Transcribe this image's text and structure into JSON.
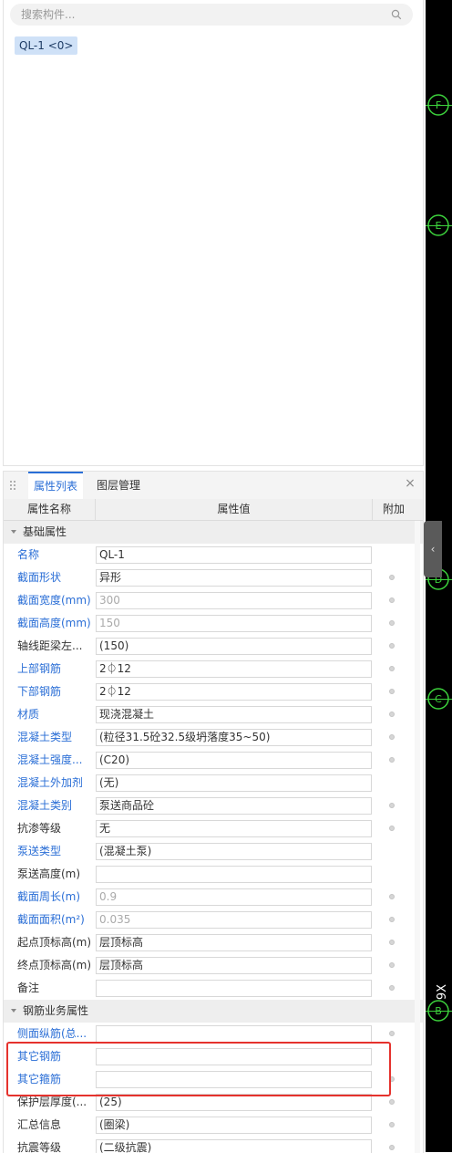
{
  "search": {
    "placeholder": "搜索构件..."
  },
  "tag": {
    "label": "QL-1 <0>"
  },
  "panel": {
    "tabs": [
      {
        "label": "属性列表"
      },
      {
        "label": "图层管理"
      }
    ],
    "close_label": "×",
    "columns": {
      "name": "属性名称",
      "value": "属性值",
      "extra": "附加"
    },
    "groups": [
      {
        "label": "基础属性"
      },
      {
        "label": "钢筋业务属性"
      }
    ],
    "rows": [
      {
        "name": "名称",
        "value": "QL-1"
      },
      {
        "name": "截面形状",
        "value": "异形"
      },
      {
        "name": "截面宽度(mm)",
        "value": "300"
      },
      {
        "name": "截面高度(mm)",
        "value": "150"
      },
      {
        "name": "轴线距梁左...",
        "value": "(150)"
      },
      {
        "name": "上部钢筋",
        "value": "2⏀12"
      },
      {
        "name": "下部钢筋",
        "value": "2⏀12"
      },
      {
        "name": "材质",
        "value": "现浇混凝土"
      },
      {
        "name": "混凝土类型",
        "value": "(粒径31.5砼32.5级坍落度35~50)"
      },
      {
        "name": "混凝土强度...",
        "value": "(C20)"
      },
      {
        "name": "混凝土外加剂",
        "value": "(无)"
      },
      {
        "name": "混凝土类别",
        "value": "泵送商品砼"
      },
      {
        "name": "抗渗等级",
        "value": "无"
      },
      {
        "name": "泵送类型",
        "value": "(混凝土泵)"
      },
      {
        "name": "泵送高度(m)",
        "value": ""
      },
      {
        "name": "截面周长(m)",
        "value": "0.9"
      },
      {
        "name": "截面面积(m²)",
        "value": "0.035"
      },
      {
        "name": "起点顶标高(m)",
        "value": "层顶标高"
      },
      {
        "name": "终点顶标高(m)",
        "value": "层顶标高"
      },
      {
        "name": "备注",
        "value": ""
      },
      {
        "name": "侧面纵筋(总...",
        "value": ""
      },
      {
        "name": "其它钢筋",
        "value": ""
      },
      {
        "name": "其它箍筋",
        "value": ""
      },
      {
        "name": "保护层厚度(...",
        "value": "(25)"
      },
      {
        "name": "汇总信息",
        "value": "(圈梁)"
      },
      {
        "name": "抗震等级",
        "value": "(二级抗震)"
      }
    ]
  },
  "viewport": {
    "axis_labels": [
      "F",
      "E",
      "D",
      "C",
      "B"
    ],
    "side_text": "9X",
    "collapse_glyph": "‹",
    "accent_color": "#3cd13c"
  },
  "colors": {
    "link_blue": "#2a6ed6",
    "highlight_red": "#e5322d",
    "background": "#ffffff"
  }
}
